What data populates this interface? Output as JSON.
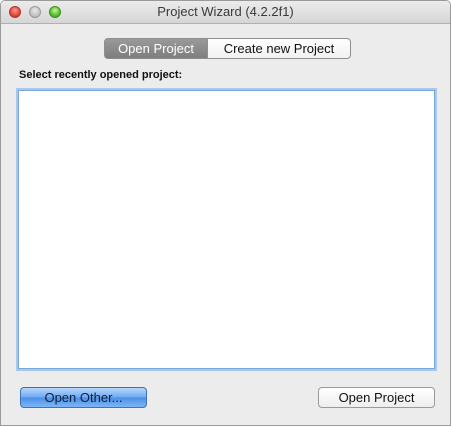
{
  "window": {
    "title": "Project Wizard (4.2.2f1)"
  },
  "tabs": [
    {
      "label": "Open Project",
      "selected": true
    },
    {
      "label": "Create new Project",
      "selected": false
    }
  ],
  "main": {
    "prompt": "Select recently opened project:",
    "recent_projects": []
  },
  "buttons": {
    "open_other": "Open Other...",
    "open_project": "Open Project"
  },
  "colors": {
    "selected_tab": "#8a8a8a",
    "default_button": "#6ea9f2",
    "focus_ring": "#a9c9ec",
    "close": "#e0443b",
    "minimize": "#c4c4c4",
    "maximize": "#58be2e"
  }
}
